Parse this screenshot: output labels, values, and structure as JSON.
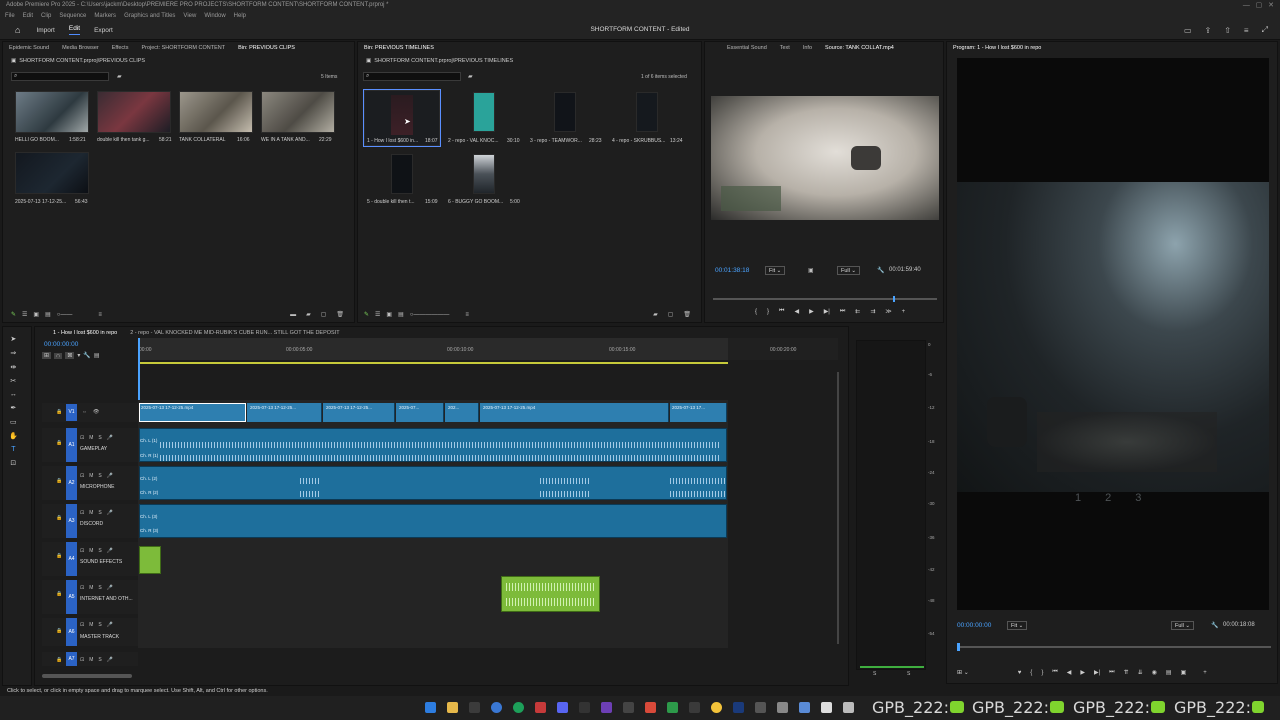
{
  "window": {
    "title": "Adobe Premiere Pro 2025 - C:\\Users\\jackm\\Desktop\\PREMIERE PRO PROJECTS\\SHORTFORM CONTENT\\SHORTFORM CONTENT.prproj *",
    "menu": [
      "File",
      "Edit",
      "Clip",
      "Sequence",
      "Markers",
      "Graphics and Titles",
      "View",
      "Window",
      "Help"
    ]
  },
  "header": {
    "tabs": [
      "Import",
      "Edit",
      "Export"
    ],
    "active_tab": "Edit",
    "project_title": "SHORTFORM CONTENT - Edited"
  },
  "left_panel": {
    "tabs": [
      "Epidemic Sound",
      "Media Browser",
      "Effects",
      "Project: SHORTFORM CONTENT",
      "Bin: PREVIOUS CLIPS"
    ],
    "path": "SHORTFORM CONTENT.prproj\\PREVIOUS CLIPS",
    "item_count": "5 Items",
    "items": [
      {
        "label": "HELLI GO BOOM...",
        "duration": "1:58:21"
      },
      {
        "label": "double kill then tank g...",
        "duration": "58:21"
      },
      {
        "label": "TANK COLLATERAL",
        "duration": "16:06"
      },
      {
        "label": "WE IN A TANK AND...",
        "duration": "22:29"
      },
      {
        "label": "2025-07-13 17-12-25...",
        "duration": "56:43"
      }
    ]
  },
  "mid_panel": {
    "tab": "Bin: PREVIOUS TIMELINES",
    "path": "SHORTFORM CONTENT.prproj\\PREVIOUS TIMELINES",
    "selection": "1 of 6 items selected",
    "items": [
      {
        "label": "1 - How I lost $600 in...",
        "duration": "18:07"
      },
      {
        "label": "2 - repo - VAL KNOC...",
        "duration": "30:10"
      },
      {
        "label": "3 - repo - TEAMWOR...",
        "duration": "28:23"
      },
      {
        "label": "4 - repo - SKRUBBUS...",
        "duration": "13:24"
      },
      {
        "label": "5 - double kill then t...",
        "duration": "15:09"
      },
      {
        "label": "6 - BUGGY GO BOOM...",
        "duration": "5:00"
      }
    ]
  },
  "source_monitor": {
    "tabs": [
      "Essential Sound",
      "Text",
      "Info",
      "Source: TANK COLLAT.mp4"
    ],
    "timecode": "00:01:38:18",
    "fit": "Fit",
    "quality": "Full",
    "duration": "00:01:59:40"
  },
  "program_monitor": {
    "tab": "Program: 1 - How I lost $600 in repo",
    "timecode": "00:00:00:00",
    "fit": "Fit",
    "quality": "Full",
    "duration": "00:00:18:08",
    "overlay_numbers": [
      "1",
      "2",
      "3"
    ]
  },
  "timeline": {
    "tabs": [
      "1 - How I lost $600 in repo",
      "2 - repo - VAL KNOCKED ME MID-RUBIK'S CUBE RUN... STILL GOT THE DEPOSIT"
    ],
    "timecode": "00:00:00:00",
    "ruler": [
      "00:00",
      "00:00:05:00",
      "00:00:10:00",
      "00:00:15:00",
      "00:00:20:00"
    ],
    "tracks": [
      {
        "id": "V1",
        "name": ""
      },
      {
        "id": "A1",
        "name": "GAMEPLAY"
      },
      {
        "id": "A2",
        "name": "MICROPHONE"
      },
      {
        "id": "A3",
        "name": "DISCORD"
      },
      {
        "id": "A4",
        "name": "SOUND EFFECTS"
      },
      {
        "id": "A5",
        "name": "INTERNET AND OTH..."
      },
      {
        "id": "A6",
        "name": "MASTER TRACK"
      },
      {
        "id": "A7",
        "name": ""
      }
    ],
    "video_clips": [
      "2025-07-13 17-12-25.mp4",
      "2025-07-13 17-12-25...",
      "2025-07-13 17-12-25...",
      "2025-07...",
      "202...",
      "2025-07-13 17-12-25.mp4",
      "2025-07-13 17..."
    ],
    "audio_labels": [
      "Ch. L (1)",
      "Ch. R (1)",
      "Ch. L (2)",
      "Ch. R (2)",
      "Ch. L (3)",
      "Ch. R (3)"
    ],
    "meter_labels": [
      "0",
      "-6",
      "-12",
      "-18",
      "-24",
      "-30",
      "-36",
      "-42",
      "-48",
      "-54"
    ]
  },
  "status": "Click to select, or click in empty space and drag to marquee select. Use Shift, Alt, and Ctrl for other options.",
  "taskbar": {
    "gpb_label": "GPB_222:"
  }
}
